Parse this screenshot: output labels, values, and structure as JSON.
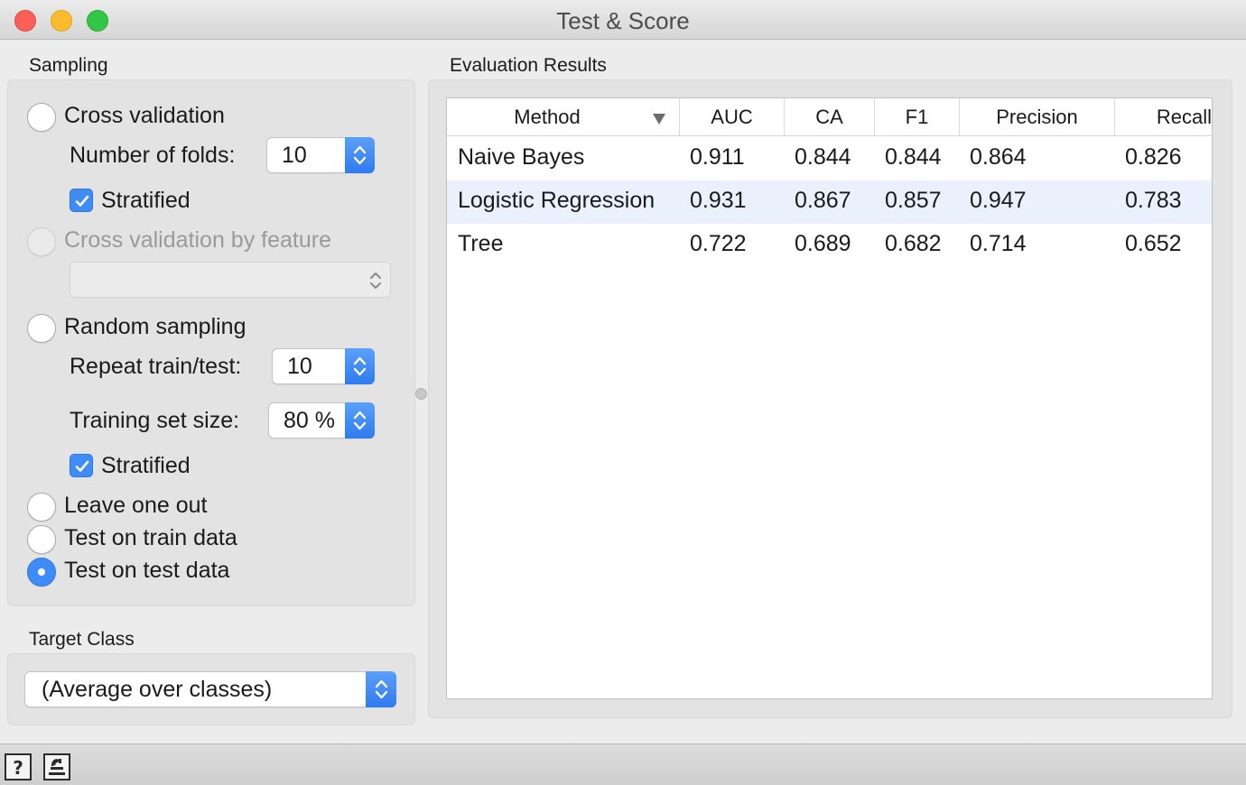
{
  "window": {
    "title": "Test & Score"
  },
  "sampling": {
    "label": "Sampling",
    "cross_validation": {
      "label": "Cross validation",
      "selected": false
    },
    "folds": {
      "label": "Number of folds:",
      "value": "10"
    },
    "stratified_cv": {
      "label": "Stratified",
      "checked": true
    },
    "cv_by_feature": {
      "label": "Cross validation by feature",
      "enabled": false,
      "value": ""
    },
    "random_sampling": {
      "label": "Random sampling",
      "selected": false
    },
    "repeat": {
      "label": "Repeat train/test:",
      "value": "10"
    },
    "train_size": {
      "label": "Training set size:",
      "value": "80 %"
    },
    "stratified_rs": {
      "label": "Stratified",
      "checked": true
    },
    "leave_one_out": {
      "label": "Leave one out",
      "selected": false
    },
    "test_on_train": {
      "label": "Test on train data",
      "selected": false
    },
    "test_on_test": {
      "label": "Test on test data",
      "selected": true
    }
  },
  "target_class": {
    "label": "Target Class",
    "value": "(Average over classes)"
  },
  "results": {
    "label": "Evaluation Results",
    "columns": [
      "Method",
      "AUC",
      "CA",
      "F1",
      "Precision",
      "Recall"
    ],
    "sort_column": "Method",
    "rows": [
      {
        "method": "Naive Bayes",
        "auc": "0.911",
        "ca": "0.844",
        "f1": "0.844",
        "precision": "0.864",
        "recall": "0.826"
      },
      {
        "method": "Logistic Regression",
        "auc": "0.931",
        "ca": "0.867",
        "f1": "0.857",
        "precision": "0.947",
        "recall": "0.783"
      },
      {
        "method": "Tree",
        "auc": "0.722",
        "ca": "0.689",
        "f1": "0.682",
        "precision": "0.714",
        "recall": "0.652"
      }
    ]
  },
  "statusbar": {
    "help_icon": "help-icon",
    "report_icon": "report-icon"
  },
  "colors": {
    "accent": "#3e8cf7",
    "selected_row": "#eaf1fd",
    "close": "#fc5f57",
    "minimize": "#fdbc2e",
    "maximize": "#33c748"
  }
}
